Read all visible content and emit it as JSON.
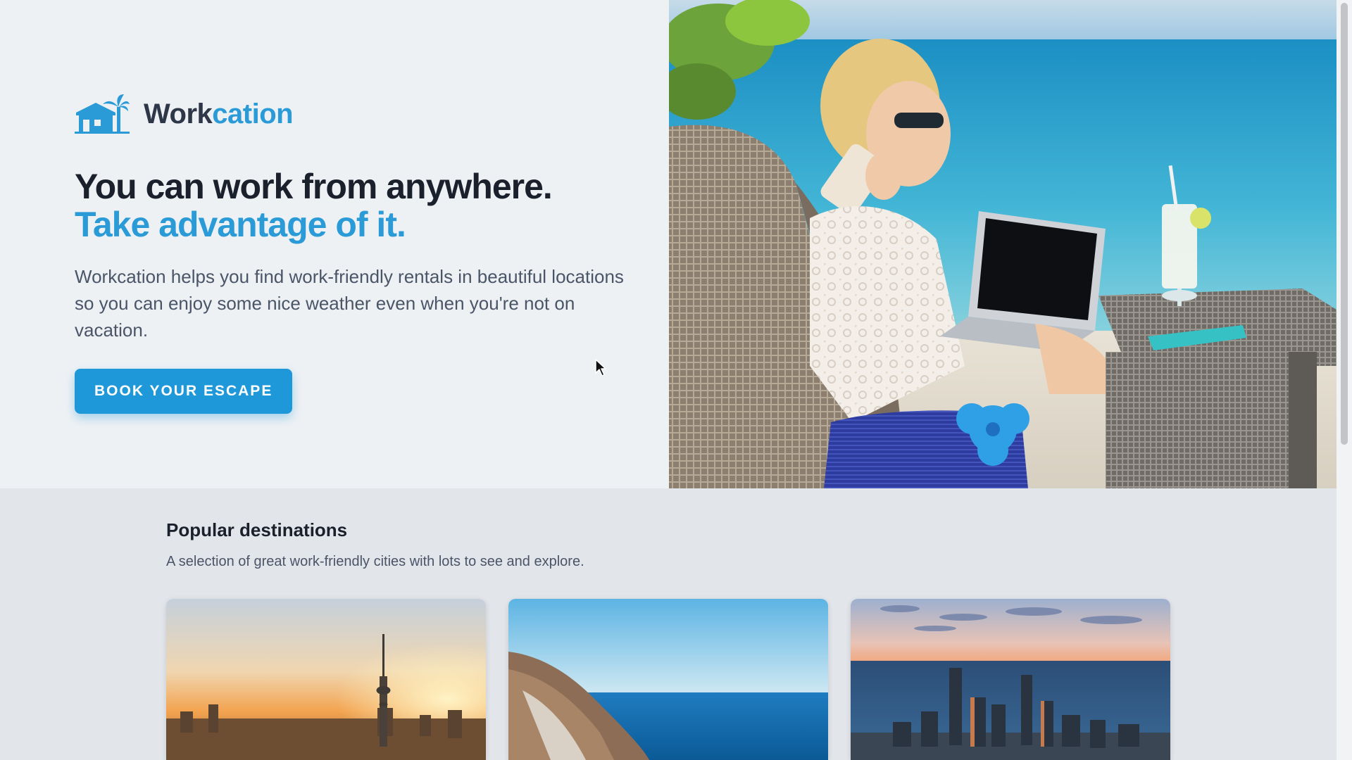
{
  "brand": {
    "name_primary": "Work",
    "name_accent": "cation"
  },
  "hero": {
    "headline": "You can work from anywhere.",
    "headline_accent": "Take advantage of it.",
    "description": "Workcation helps you find work-friendly rentals in beautiful locations so you can enjoy some nice weather even when you're not on vacation.",
    "cta_label": "BOOK YOUR ESCAPE"
  },
  "destinations": {
    "title": "Popular destinations",
    "subtitle": "A selection of great work-friendly cities with lots to see and explore."
  },
  "colors": {
    "brand_blue": "#2b9bd8",
    "button_blue": "#1e98d9",
    "heading": "#1a202c",
    "body_text": "#4a5568",
    "hero_bg": "#eef1f4",
    "section_bg": "#e2e5ea"
  },
  "icons": {
    "logo": "house-with-palm-tree-icon",
    "cursor": "mouse-pointer-icon"
  }
}
